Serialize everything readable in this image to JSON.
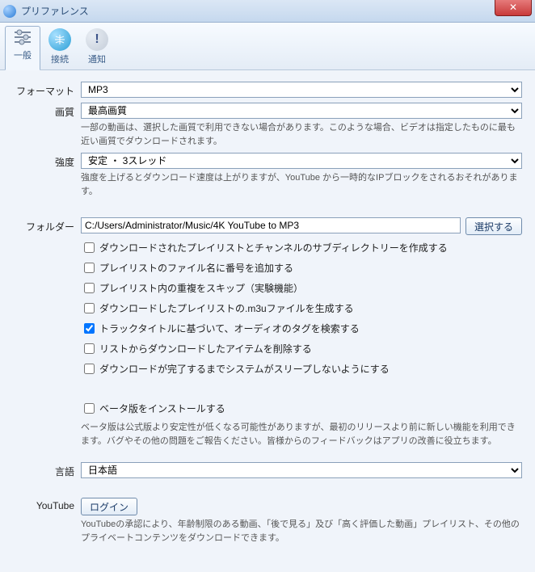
{
  "window": {
    "title": "プリファレンス"
  },
  "tabs": {
    "general": "一般",
    "connection": "接続",
    "notifications": "通知"
  },
  "format": {
    "label": "フォーマット",
    "value": "MP3"
  },
  "quality": {
    "label": "画質",
    "value": "最高画質",
    "hint": "一部の動画は、選択した画質で利用できない場合があります。このような場合、ビデオは指定したものに最も近い画質でダウンロードされます。"
  },
  "intensity": {
    "label": "強度",
    "value": "安定 ・ 3スレッド",
    "hint": "強度を上げるとダウンロード速度は上がりますが、YouTube から一時的なIPブロックをされるおそれがあります。"
  },
  "folder": {
    "label": "フォルダー",
    "value": "C:/Users/Administrator/Music/4K YouTube to MP3",
    "select_label": "選択する"
  },
  "checks": {
    "subdir": "ダウンロードされたプレイリストとチャンネルのサブディレクトリーを作成する",
    "number": "プレイリストのファイル名に番号を追加する",
    "skipdup": "プレイリスト内の重複をスキップ（実験機能）",
    "m3u": "ダウンロードしたプレイリストの.m3uファイルを生成する",
    "tags": "トラックタイトルに基づいて、オーディオのタグを検索する",
    "remove": "リストからダウンロードしたアイテムを削除する",
    "nosleep": "ダウンロードが完了するまでシステムがスリープしないようにする"
  },
  "beta": {
    "check": "ベータ版をインストールする",
    "hint": "ベータ版は公式版より安定性が低くなる可能性がありますが、最初のリリースより前に新しい機能を利用できます。バグやその他の問題をご報告ください。皆様からのフィードバックはアプリの改善に役立ちます。"
  },
  "language": {
    "label": "言語",
    "value": "日本語"
  },
  "youtube": {
    "label": "YouTube",
    "login": "ログイン",
    "hint": "YouTubeの承認により、年齢制限のある動画、「後で見る」及び「高く評価した動画」プレイリスト、その他のプライベートコンテンツをダウンロードできます。"
  }
}
